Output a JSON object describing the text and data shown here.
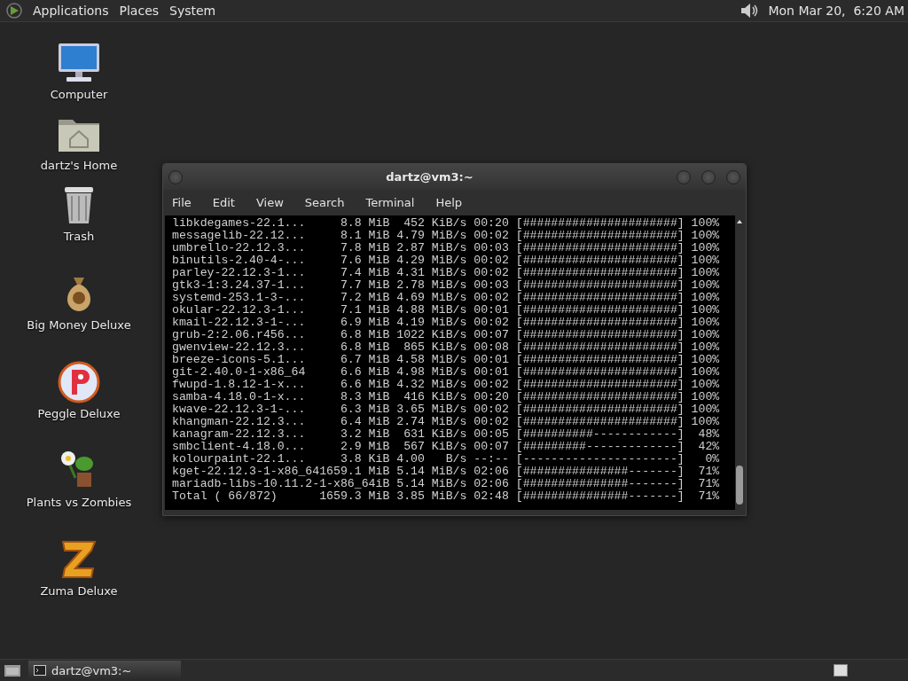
{
  "top_panel": {
    "menus": [
      "Applications",
      "Places",
      "System"
    ],
    "clock": "Mon Mar 20,  6:20 AM"
  },
  "desktop_icons": [
    {
      "kind": "computer",
      "label": "Computer"
    },
    {
      "kind": "home",
      "label": "dartz's Home"
    },
    {
      "kind": "trash",
      "label": "Trash"
    },
    {
      "kind": "money",
      "label": "Big Money Deluxe"
    },
    {
      "kind": "peggle",
      "label": "Peggle Deluxe"
    },
    {
      "kind": "plant",
      "label": "Plants vs Zombies"
    },
    {
      "kind": "zuma",
      "label": "Zuma Deluxe"
    }
  ],
  "terminal": {
    "title": "dartz@vm3:~",
    "menu": [
      "File",
      "Edit",
      "View",
      "Search",
      "Terminal",
      "Help"
    ],
    "lines": [
      "libkdegames-22.1...     8.8 MiB  452 KiB/s 00:20 [######################] 100%",
      "messagelib-22.12...     8.1 MiB 4.79 MiB/s 00:02 [######################] 100%",
      "umbrello-22.12.3...     7.8 MiB 2.87 MiB/s 00:03 [######################] 100%",
      "binutils-2.40-4-...     7.6 MiB 4.29 MiB/s 00:02 [######################] 100%",
      "parley-22.12.3-1...     7.4 MiB 4.31 MiB/s 00:02 [######################] 100%",
      "gtk3-1:3.24.37-1...     7.7 MiB 2.78 MiB/s 00:03 [######################] 100%",
      "systemd-253.1-3-...     7.2 MiB 4.69 MiB/s 00:02 [######################] 100%",
      "okular-22.12.3-1...     7.1 MiB 4.88 MiB/s 00:01 [######################] 100%",
      "kmail-22.12.3-1-...     6.9 MiB 4.19 MiB/s 00:02 [######################] 100%",
      "grub-2:2.06.r456...     6.8 MiB 1022 KiB/s 00:07 [######################] 100%",
      "gwenview-22.12.3...     6.8 MiB  865 KiB/s 00:08 [######################] 100%",
      "breeze-icons-5.1...     6.7 MiB 4.58 MiB/s 00:01 [######################] 100%",
      "git-2.40.0-1-x86_64     6.6 MiB 4.98 MiB/s 00:01 [######################] 100%",
      "fwupd-1.8.12-1-x...     6.6 MiB 4.32 MiB/s 00:02 [######################] 100%",
      "samba-4.18.0-1-x...     8.3 MiB  416 KiB/s 00:20 [######################] 100%",
      "kwave-22.12.3-1-...     6.3 MiB 3.65 MiB/s 00:02 [######################] 100%",
      "khangman-22.12.3...     6.4 MiB 2.74 MiB/s 00:02 [######################] 100%",
      "kanagram-22.12.3...     3.2 MiB  631 KiB/s 00:05 [##########------------]  48%",
      "smbclient-4.18.0...     2.9 MiB  567 KiB/s 00:07 [#########-------------]  42%",
      "kolourpaint-22.1...     3.8 KiB 4.00   B/s --:-- [----------------------]   0%",
      "kget-22.12.3-1-x86_641659.1 MiB 5.14 MiB/s 02:06 [###############-------]  71%",
      "mariadb-libs-10.11.2-1-x86_64iB 5.14 MiB/s 02:06 [###############-------]  71%",
      "Total ( 66/872)      1659.3 MiB 3.85 MiB/s 02:48 [###############-------]  71%"
    ]
  },
  "taskbar": {
    "tasks": [
      {
        "label": "dartz@vm3:~",
        "selected": true
      }
    ]
  }
}
